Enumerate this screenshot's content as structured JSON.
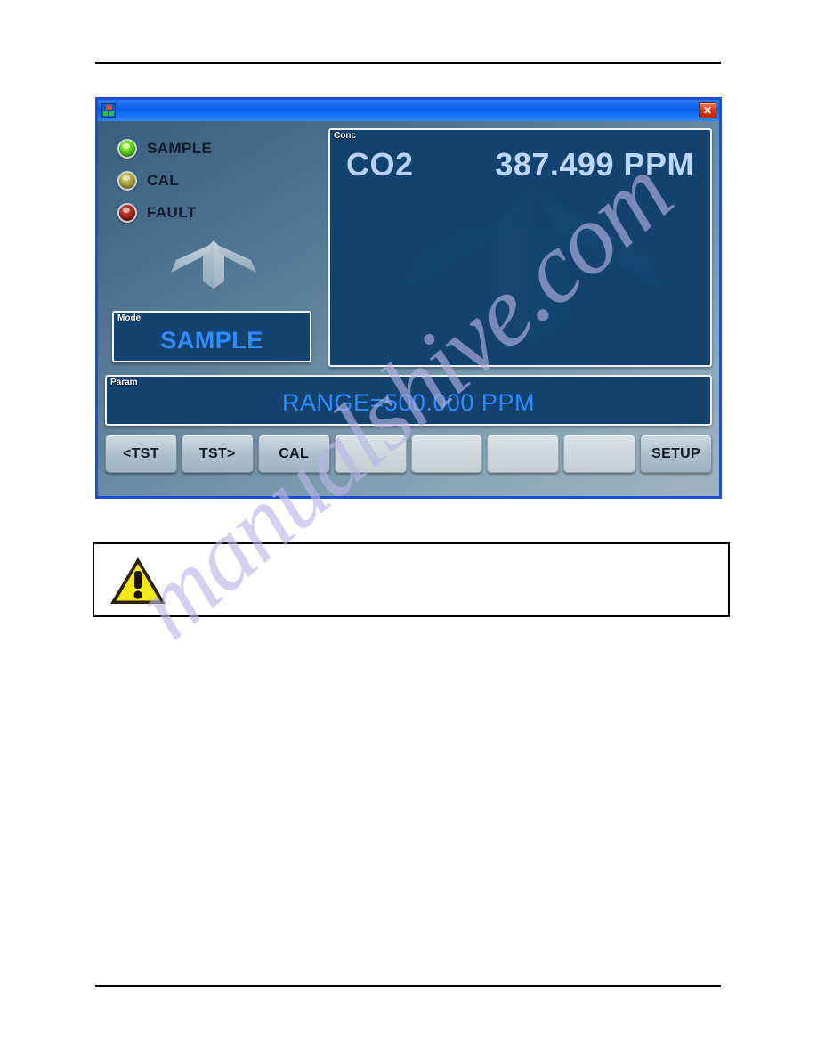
{
  "window": {
    "title": "",
    "app_icon": "analyzer-app-icon",
    "close_label": "✕"
  },
  "status_leds": [
    {
      "label": "SAMPLE",
      "state": "on",
      "color": "#63d615"
    },
    {
      "label": "CAL",
      "state": "off",
      "color": "#b0a43a"
    },
    {
      "label": "FAULT",
      "state": "off",
      "color": "#a82318"
    }
  ],
  "mode_panel": {
    "tag": "Mode",
    "value": "SAMPLE"
  },
  "conc_panel": {
    "tag": "Conc",
    "gas": "CO2",
    "reading": "387.499 PPM"
  },
  "param_panel": {
    "tag": "Param",
    "value": "RANGE=500.000 PPM"
  },
  "buttons": [
    {
      "label": "<TST",
      "state": "active"
    },
    {
      "label": "TST>",
      "state": "active"
    },
    {
      "label": "CAL",
      "state": "active"
    },
    {
      "label": "",
      "state": "blank"
    },
    {
      "label": "",
      "state": "blank"
    },
    {
      "label": "",
      "state": "blank"
    },
    {
      "label": "",
      "state": "blank"
    },
    {
      "label": "SETUP",
      "state": "active"
    }
  ],
  "note_box": {
    "icon": "warning-triangle-icon",
    "text": ""
  },
  "watermark": {
    "text": "manualshive.com",
    "color": "#b9b6e6"
  },
  "colors": {
    "titlebar_blue": "#0a5cea",
    "window_border": "#1a4fd6",
    "panel_navy": "#13426e",
    "display_blue": "#2d8cff",
    "reading_blue": "#bcd6f7",
    "warning_yellow": "#f3e81c"
  }
}
